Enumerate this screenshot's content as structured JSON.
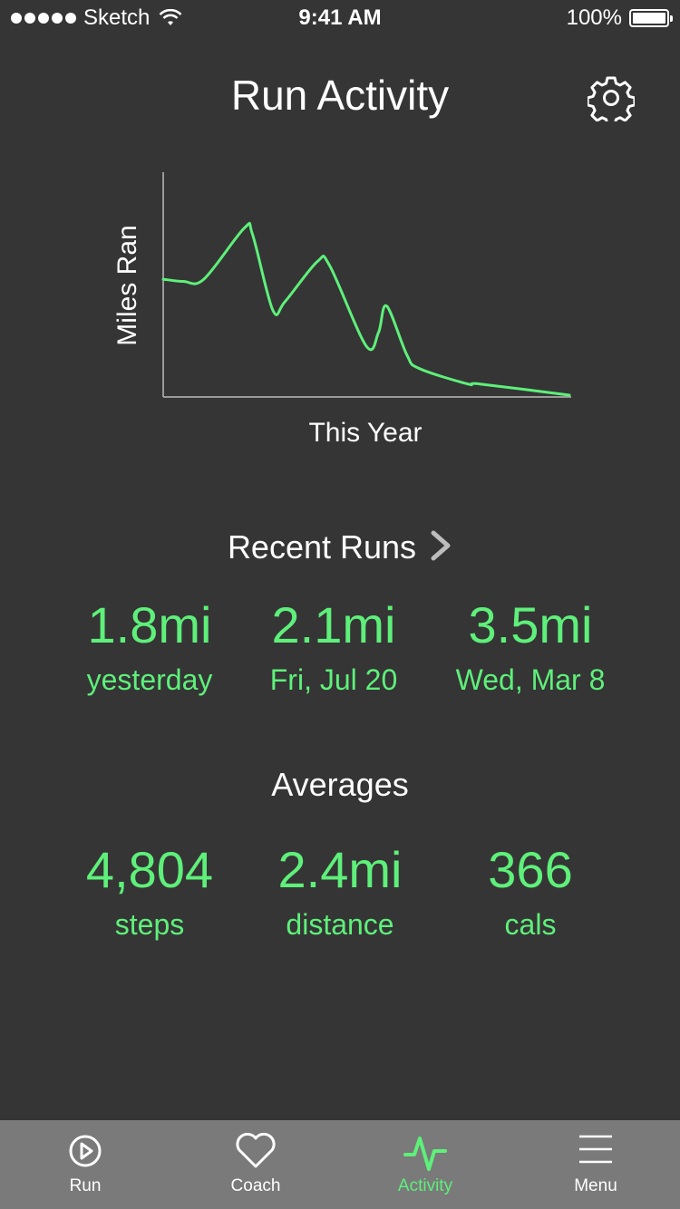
{
  "status_bar": {
    "carrier": "Sketch",
    "time": "9:41 AM",
    "battery": "100%"
  },
  "header": {
    "title": "Run Activity",
    "settings_icon": "gear-icon"
  },
  "chart_data": {
    "type": "line",
    "xlabel": "This Year",
    "ylabel": "Miles Ran",
    "ticks_shown": false,
    "line_color": "#5ef07a",
    "note": "unlabeled curve, values in relative units 0-100",
    "x": [
      0,
      5,
      10,
      20,
      22,
      27,
      30,
      38,
      41,
      50,
      53,
      55,
      60,
      63,
      75,
      78,
      100
    ],
    "y": [
      52,
      51,
      52,
      75,
      72,
      38,
      42,
      60,
      58,
      22,
      28,
      40,
      18,
      12,
      5,
      5,
      0
    ]
  },
  "recent_runs": {
    "title": "Recent Runs",
    "arrow_icon": "chevron-right-icon",
    "items": [
      {
        "value": "1.8mi",
        "label": "yesterday"
      },
      {
        "value": "2.1mi",
        "label": "Fri, Jul 20"
      },
      {
        "value": "3.5mi",
        "label": "Wed, Mar 8"
      }
    ]
  },
  "averages": {
    "title": "Averages",
    "items": [
      {
        "value": "4,804",
        "label": "steps"
      },
      {
        "value": "2.4mi",
        "label": "distance"
      },
      {
        "value": "366",
        "label": "cals"
      }
    ]
  },
  "tab_bar": {
    "tabs": [
      {
        "label": "Run",
        "icon": "play-circle-icon",
        "active": false
      },
      {
        "label": "Coach",
        "icon": "heart-icon",
        "active": false
      },
      {
        "label": "Activity",
        "icon": "activity-pulse-icon",
        "active": true
      },
      {
        "label": "Menu",
        "icon": "hamburger-menu-icon",
        "active": false
      }
    ]
  },
  "colors": {
    "background": "#353535",
    "accent": "#5ef07a",
    "tab_bar": "#7a7a7a",
    "text": "#ffffff"
  }
}
